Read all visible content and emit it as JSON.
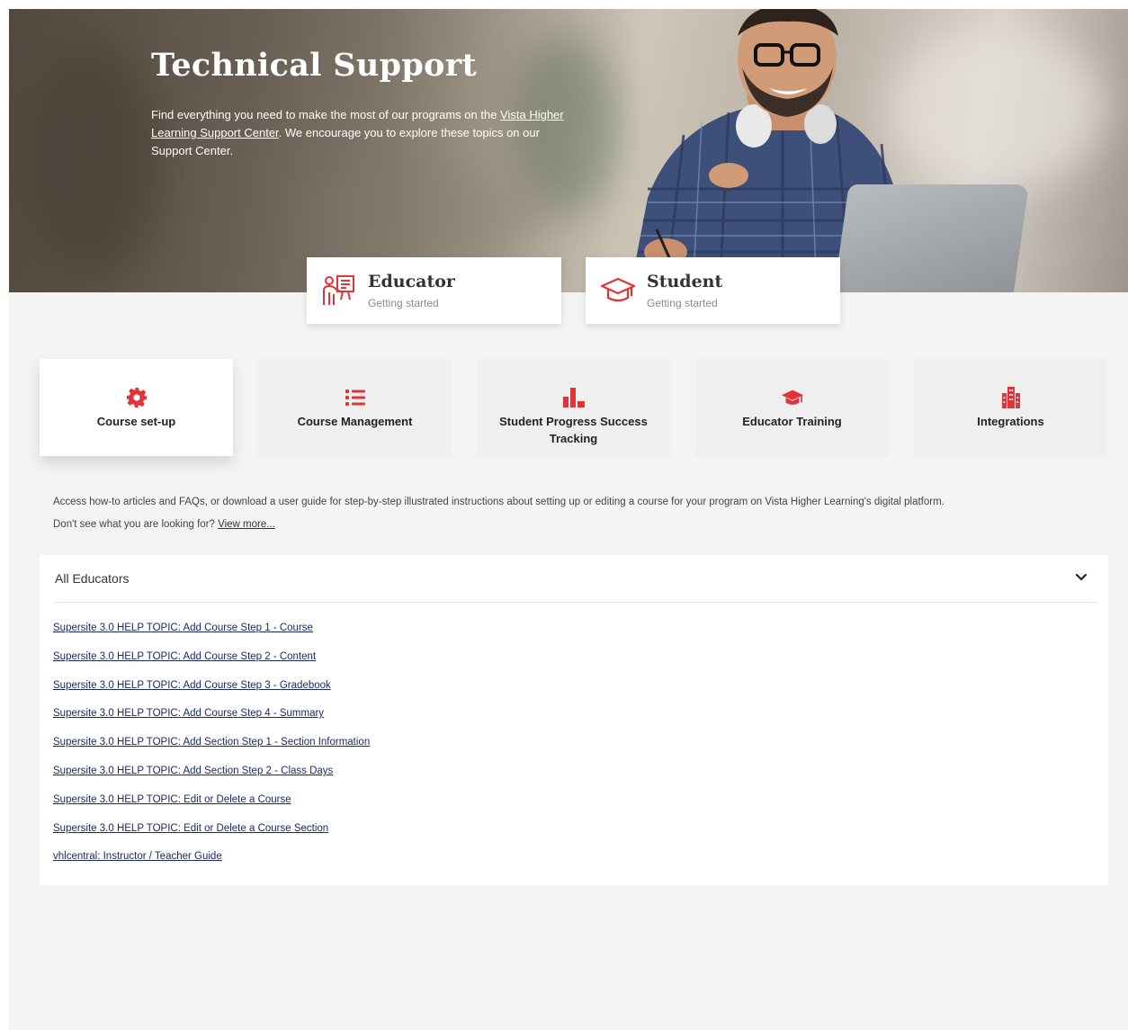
{
  "hero": {
    "title": "Technical Support",
    "desc_before": "Find everything you need to make the most of our programs on the ",
    "desc_link": "Vista Higher Learning Support Center",
    "desc_after": ". We encourage you to explore these topics on our Support Center."
  },
  "roles": [
    {
      "title": "Educator",
      "subtitle": "Getting started",
      "icon": "teacher-board-icon"
    },
    {
      "title": "Student",
      "subtitle": "Getting started",
      "icon": "graduation-cap-icon"
    }
  ],
  "categories": [
    {
      "label": "Course set-up",
      "icon": "gear-icon",
      "active": true
    },
    {
      "label": "Course Management",
      "icon": "list-icon",
      "active": false
    },
    {
      "label": "Student Progress Success Tracking",
      "icon": "bar-chart-icon",
      "active": false
    },
    {
      "label": "Educator Training",
      "icon": "graduation-cap-icon",
      "active": false
    },
    {
      "label": "Integrations",
      "icon": "building-icon",
      "active": false
    }
  ],
  "intro": {
    "line1": "Access how-to articles and FAQs, or download a user guide for step-by-step illustrated instructions about setting up or editing a course for your program on Vista Higher Learning's digital platform.",
    "line2_before": "Don't see what you are looking for? ",
    "line2_link": "View more..."
  },
  "accordion": {
    "title": "All Educators",
    "links": [
      "Supersite 3.0 HELP TOPIC: Add Course Step 1 - Course",
      "Supersite 3.0 HELP TOPIC: Add Course Step 2 - Content",
      "Supersite 3.0 HELP TOPIC: Add Course Step 3 - Gradebook",
      "Supersite 3.0 HELP TOPIC: Add Course Step 4 - Summary",
      "Supersite 3.0 HELP TOPIC: Add Section Step 1 - Section Information",
      "Supersite 3.0 HELP TOPIC: Add Section Step 2 - Class Days",
      "Supersite 3.0 HELP TOPIC: Edit or Delete a Course",
      "Supersite 3.0 HELP TOPIC: Edit or Delete a Course Section",
      "vhlcentral: Instructor / Teacher Guide"
    ]
  },
  "colors": {
    "accent": "#e2333a",
    "link": "#1c2a63",
    "background": "#f4f4f4"
  }
}
